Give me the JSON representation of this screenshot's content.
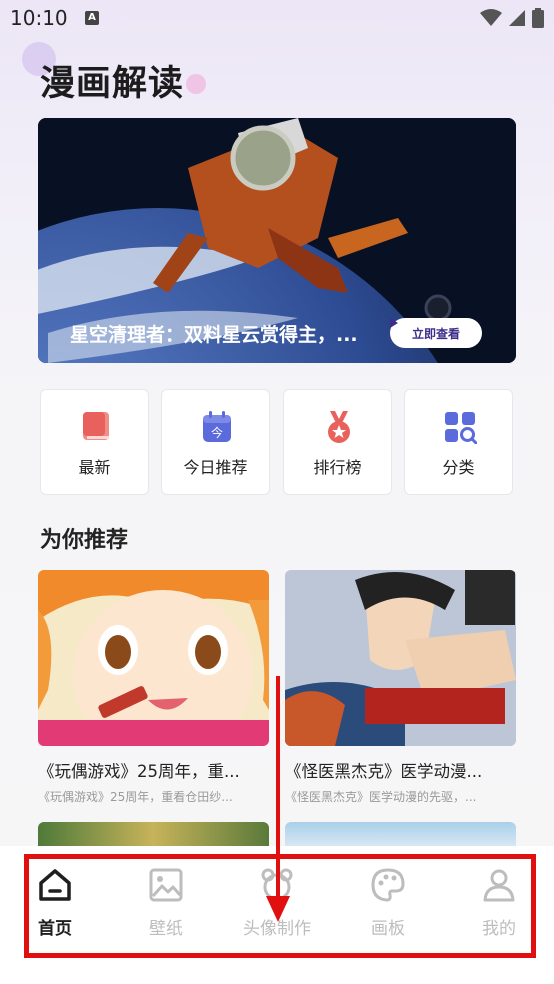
{
  "status": {
    "time": "10:10",
    "notification_glyph": "A"
  },
  "header": {
    "title": "漫画解读"
  },
  "banner": {
    "caption": "星空清理者：双料星云赏得主，...",
    "button_label": "立即查看"
  },
  "quick_actions": [
    {
      "label": "最新",
      "icon": "book-icon",
      "color": "#e9615c"
    },
    {
      "label": "今日推荐",
      "icon": "calendar-today-icon",
      "color": "#5b6bdc",
      "badge": "今"
    },
    {
      "label": "排行榜",
      "icon": "medal-icon",
      "color": "#e9615c"
    },
    {
      "label": "分类",
      "icon": "category-grid-icon",
      "color": "#5b6bdc"
    }
  ],
  "section": {
    "title": "为你推荐"
  },
  "cards": [
    {
      "title": "《玩偶游戏》25周年，重...",
      "subtitle": "《玩偶游戏》25周年，重看仓田纱..."
    },
    {
      "title": "《怪医黑杰克》医学动漫...",
      "subtitle": "《怪医黑杰克》医学动漫的先驱，..."
    }
  ],
  "tabs": [
    {
      "label": "首页",
      "icon": "home-icon",
      "active": true
    },
    {
      "label": "壁纸",
      "icon": "image-icon",
      "active": false
    },
    {
      "label": "头像制作",
      "icon": "avatar-bear-icon",
      "active": false
    },
    {
      "label": "画板",
      "icon": "palette-icon",
      "active": false
    },
    {
      "label": "我的",
      "icon": "user-icon",
      "active": false
    }
  ],
  "colors": {
    "accent": "#3f2d8c",
    "highlight_frame": "#e01010",
    "tab_active": "#1f1f1f",
    "tab_inactive": "#bdbdbd"
  }
}
